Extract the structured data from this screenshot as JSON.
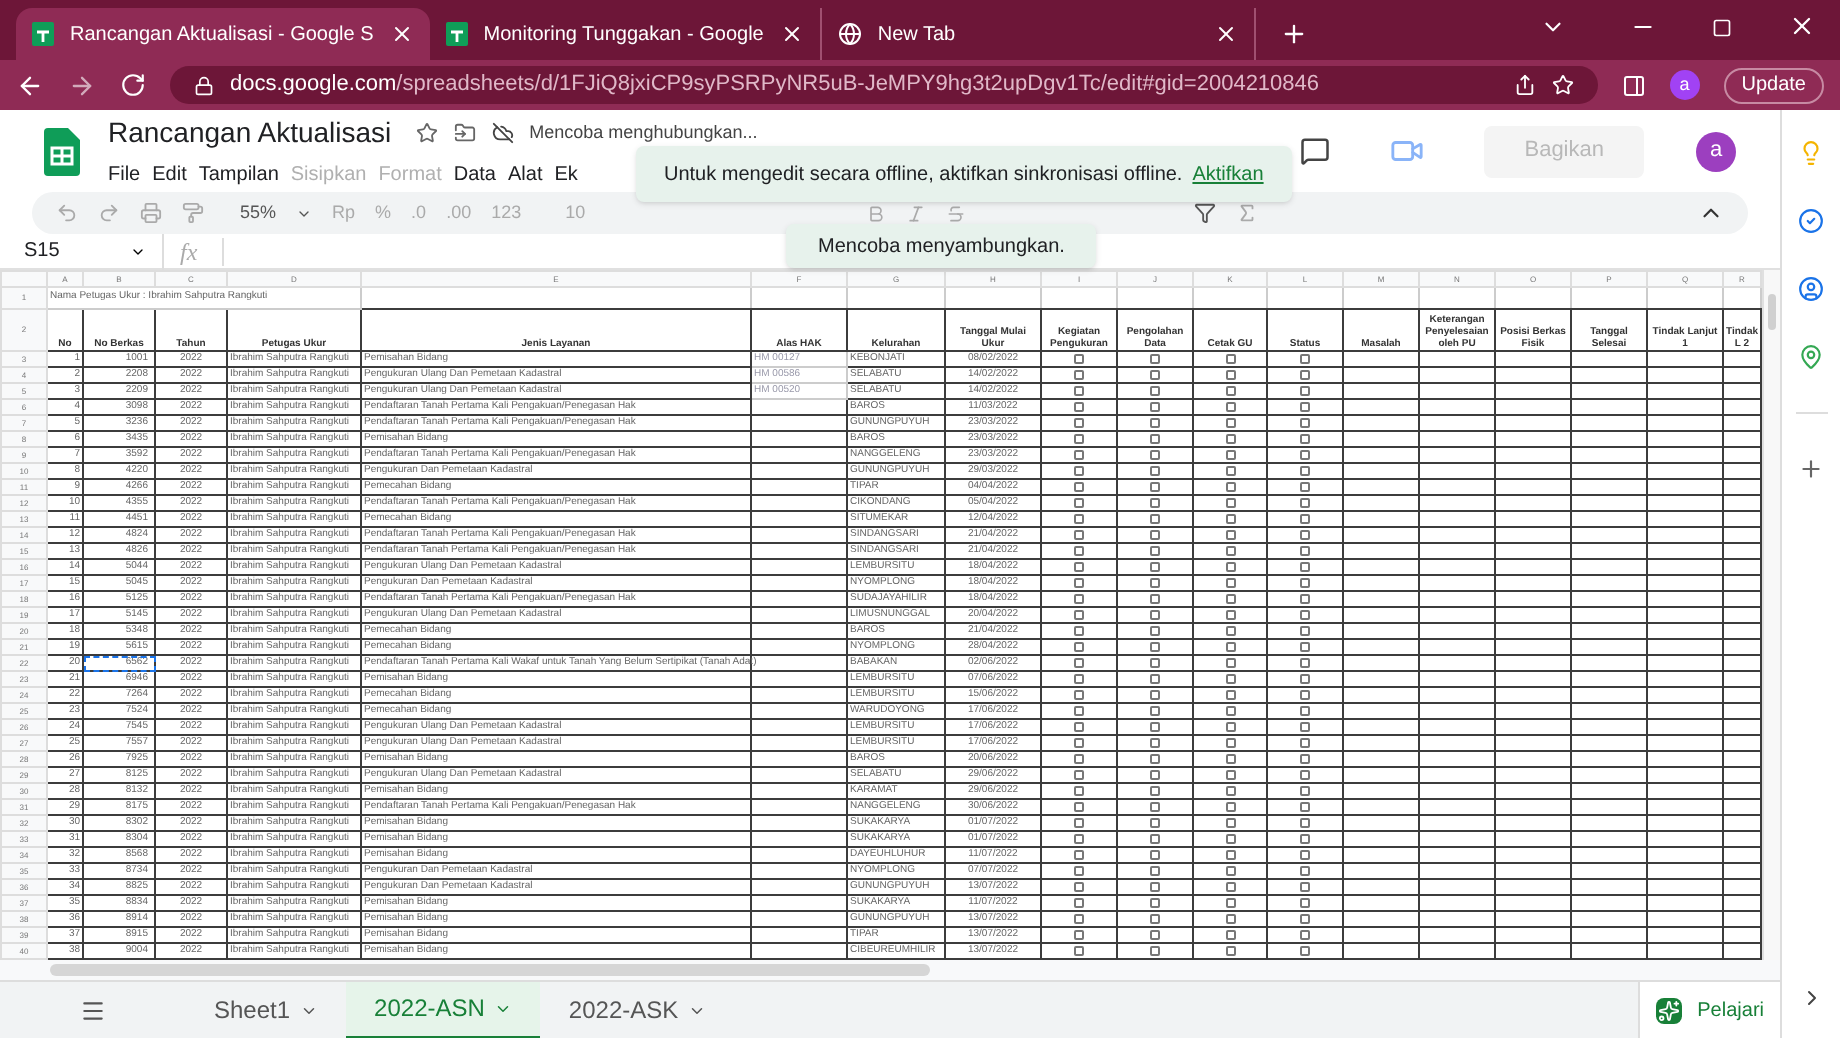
{
  "browser": {
    "tabs": [
      {
        "title": "Rancangan Aktualisasi - Google S",
        "selected": true
      },
      {
        "title": "Monitoring Tunggakan - Google",
        "selected": false
      },
      {
        "title": "New Tab",
        "selected": false
      }
    ],
    "url_host": "docs.google.com",
    "url_path": "/spreadsheets/d/1FJiQ8jxiCP9syPSRPyNR5uB-JeMPY9hg3t2upDgv1Tc/edit#gid=2004210846",
    "profile": "a",
    "update_button": "Update"
  },
  "document": {
    "title": "Rancangan Aktualisasi",
    "status": "Mencoba menghubungkan...",
    "share_button": "Bagikan",
    "avatar": "a",
    "menu": [
      {
        "label": "File",
        "disabled": false
      },
      {
        "label": "Edit",
        "disabled": false
      },
      {
        "label": "Tampilan",
        "disabled": false
      },
      {
        "label": "Sisipkan",
        "disabled": true
      },
      {
        "label": "Format",
        "disabled": true
      },
      {
        "label": "Data",
        "disabled": false
      },
      {
        "label": "Alat",
        "disabled": false
      },
      {
        "label": "Ek",
        "disabled": false
      }
    ]
  },
  "toolbar": {
    "zoom": "55%",
    "items": [
      "Rp",
      "%",
      ".0",
      ".00",
      "123"
    ],
    "font_size": "10"
  },
  "formula_bar": {
    "cell": "S15",
    "fx": "fx"
  },
  "notifications": [
    {
      "text": "Untuk mengedit secara offline, aktifkan sinkronisasi offline.",
      "link": "Aktifkan"
    },
    {
      "text": "Mencoba menyambungkan."
    }
  ],
  "sheet": {
    "column_letters": [
      "A",
      "B",
      "C",
      "D",
      "E",
      "F",
      "G",
      "H",
      "I",
      "J",
      "K",
      "L",
      "M",
      "N",
      "O",
      "P",
      "Q",
      "R"
    ],
    "title_row": {
      "row_label": "1",
      "text": "Nama Petugas Ukur : Ibrahim Sahputra Rangkuti"
    },
    "header_row": {
      "row_label": "2",
      "headers": [
        "No",
        "No Berkas",
        "Tahun",
        "Petugas Ukur",
        "Jenis Layanan",
        "Alas HAK",
        "Kelurahan",
        "Tanggal Mulai Ukur",
        "Kegiatan Pengukuran",
        "Pengolahan Data",
        "Cetak GU",
        "Status",
        "Masalah",
        "Keterangan Penyelesaian oleh PU",
        "Posisi Berkas Fisik",
        "Tanggal Selesai",
        "Tindak Lanjut 1",
        "Tindak L 2"
      ]
    },
    "rows": [
      {
        "row_label": "3",
        "no": "1",
        "berkas": "1001",
        "tahun": "2022",
        "petugas": "Ibrahim Sahputra Rangkuti",
        "layanan": "Pemisahan Bidang",
        "alas_hak": "HM 00127",
        "kelurahan": "KEBONJATI",
        "tanggal": "08/02/2022",
        "pengukuran": false,
        "pengolahan": false,
        "cetak_gu": false,
        "status": false,
        "copied": false
      },
      {
        "row_label": "4",
        "no": "2",
        "berkas": "2208",
        "tahun": "2022",
        "petugas": "Ibrahim Sahputra Rangkuti",
        "layanan": "Pengukuran Ulang Dan Pemetaan Kadastral",
        "alas_hak": "HM 00586",
        "kelurahan": "SELABATU",
        "tanggal": "14/02/2022",
        "pengukuran": false,
        "pengolahan": false,
        "cetak_gu": false,
        "status": false,
        "copied": false
      },
      {
        "row_label": "5",
        "no": "3",
        "berkas": "2209",
        "tahun": "2022",
        "petugas": "Ibrahim Sahputra Rangkuti",
        "layanan": "Pengukuran Ulang Dan Pemetaan Kadastral",
        "alas_hak": "HM 00520",
        "kelurahan": "SELABATU",
        "tanggal": "14/02/2022",
        "pengukuran": false,
        "pengolahan": false,
        "cetak_gu": false,
        "status": false,
        "copied": false
      },
      {
        "row_label": "6",
        "no": "4",
        "berkas": "3098",
        "tahun": "2022",
        "petugas": "Ibrahim Sahputra Rangkuti",
        "layanan": "Pendaftaran Tanah Pertama Kali Pengakuan/Penegasan Hak",
        "kelurahan": "BAROS",
        "tanggal": "11/03/2022",
        "pengukuran": false,
        "pengolahan": false,
        "cetak_gu": false,
        "status": false,
        "copied": false
      },
      {
        "row_label": "7",
        "no": "5",
        "berkas": "3236",
        "tahun": "2022",
        "petugas": "Ibrahim Sahputra Rangkuti",
        "layanan": "Pendaftaran Tanah Pertama Kali Pengakuan/Penegasan Hak",
        "kelurahan": "GUNUNGPUYUH",
        "tanggal": "23/03/2022",
        "pengukuran": false,
        "pengolahan": false,
        "cetak_gu": false,
        "status": false,
        "copied": false
      },
      {
        "row_label": "8",
        "no": "6",
        "berkas": "3435",
        "tahun": "2022",
        "petugas": "Ibrahim Sahputra Rangkuti",
        "layanan": "Pemisahan Bidang",
        "kelurahan": "BAROS",
        "tanggal": "23/03/2022",
        "pengukuran": false,
        "pengolahan": false,
        "cetak_gu": false,
        "status": false,
        "copied": false
      },
      {
        "row_label": "9",
        "no": "7",
        "berkas": "3592",
        "tahun": "2022",
        "petugas": "Ibrahim Sahputra Rangkuti",
        "layanan": "Pendaftaran Tanah Pertama Kali Pengakuan/Penegasan Hak",
        "kelurahan": "NANGGELENG",
        "tanggal": "23/03/2022",
        "pengukuran": false,
        "pengolahan": false,
        "cetak_gu": false,
        "status": false,
        "copied": false
      },
      {
        "row_label": "10",
        "no": "8",
        "berkas": "4220",
        "tahun": "2022",
        "petugas": "Ibrahim Sahputra Rangkuti",
        "layanan": "Pengukuran Dan Pemetaan Kadastral",
        "kelurahan": "GUNUNGPUYUH",
        "tanggal": "29/03/2022",
        "pengukuran": false,
        "pengolahan": false,
        "cetak_gu": false,
        "status": false,
        "copied": false
      },
      {
        "row_label": "11",
        "no": "9",
        "berkas": "4266",
        "tahun": "2022",
        "petugas": "Ibrahim Sahputra Rangkuti",
        "layanan": "Pemecahan Bidang",
        "kelurahan": "TIPAR",
        "tanggal": "04/04/2022",
        "pengukuran": false,
        "pengolahan": false,
        "cetak_gu": false,
        "status": false,
        "copied": false
      },
      {
        "row_label": "12",
        "no": "10",
        "berkas": "4355",
        "tahun": "2022",
        "petugas": "Ibrahim Sahputra Rangkuti",
        "layanan": "Pendaftaran Tanah Pertama Kali Pengakuan/Penegasan Hak",
        "kelurahan": "CIKONDANG",
        "tanggal": "05/04/2022",
        "pengukuran": false,
        "pengolahan": false,
        "cetak_gu": false,
        "status": false,
        "copied": false
      },
      {
        "row_label": "13",
        "no": "11",
        "berkas": "4451",
        "tahun": "2022",
        "petugas": "Ibrahim Sahputra Rangkuti",
        "layanan": "Pemecahan Bidang",
        "kelurahan": "SITUMEKAR",
        "tanggal": "12/04/2022",
        "pengukuran": false,
        "pengolahan": false,
        "cetak_gu": false,
        "status": false,
        "copied": false
      },
      {
        "row_label": "14",
        "no": "12",
        "berkas": "4824",
        "tahun": "2022",
        "petugas": "Ibrahim Sahputra Rangkuti",
        "layanan": "Pendaftaran Tanah Pertama Kali Pengakuan/Penegasan Hak",
        "kelurahan": "SINDANGSARI",
        "tanggal": "21/04/2022",
        "pengukuran": false,
        "pengolahan": false,
        "cetak_gu": false,
        "status": false,
        "copied": false
      },
      {
        "row_label": "15",
        "no": "13",
        "berkas": "4826",
        "tahun": "2022",
        "petugas": "Ibrahim Sahputra Rangkuti",
        "layanan": "Pendaftaran Tanah Pertama Kali Pengakuan/Penegasan Hak",
        "kelurahan": "SINDANGSARI",
        "tanggal": "21/04/2022",
        "pengukuran": false,
        "pengolahan": false,
        "cetak_gu": false,
        "status": false,
        "copied": false
      },
      {
        "row_label": "16",
        "no": "14",
        "berkas": "5044",
        "tahun": "2022",
        "petugas": "Ibrahim Sahputra Rangkuti",
        "layanan": "Pengukuran Ulang Dan Pemetaan Kadastral",
        "kelurahan": "LEMBURSITU",
        "tanggal": "18/04/2022",
        "pengukuran": false,
        "pengolahan": false,
        "cetak_gu": false,
        "status": false,
        "copied": false
      },
      {
        "row_label": "17",
        "no": "15",
        "berkas": "5045",
        "tahun": "2022",
        "petugas": "Ibrahim Sahputra Rangkuti",
        "layanan": "Pengukuran Dan Pemetaan Kadastral",
        "kelurahan": "NYOMPLONG",
        "tanggal": "18/04/2022",
        "pengukuran": false,
        "pengolahan": false,
        "cetak_gu": false,
        "status": false,
        "copied": false
      },
      {
        "row_label": "18",
        "no": "16",
        "berkas": "5125",
        "tahun": "2022",
        "petugas": "Ibrahim Sahputra Rangkuti",
        "layanan": "Pendaftaran Tanah Pertama Kali Pengakuan/Penegasan Hak",
        "kelurahan": "SUDAJAYAHILIR",
        "tanggal": "18/04/2022",
        "pengukuran": false,
        "pengolahan": false,
        "cetak_gu": false,
        "status": false,
        "copied": false
      },
      {
        "row_label": "19",
        "no": "17",
        "berkas": "5145",
        "tahun": "2022",
        "petugas": "Ibrahim Sahputra Rangkuti",
        "layanan": "Pengukuran Ulang Dan Pemetaan Kadastral",
        "kelurahan": "LIMUSNUNGGAL",
        "tanggal": "20/04/2022",
        "pengukuran": false,
        "pengolahan": false,
        "cetak_gu": false,
        "status": false,
        "copied": false
      },
      {
        "row_label": "20",
        "no": "18",
        "berkas": "5348",
        "tahun": "2022",
        "petugas": "Ibrahim Sahputra Rangkuti",
        "layanan": "Pemecahan Bidang",
        "kelurahan": "BAROS",
        "tanggal": "21/04/2022",
        "pengukuran": false,
        "pengolahan": false,
        "cetak_gu": false,
        "status": false,
        "copied": false
      },
      {
        "row_label": "21",
        "no": "19",
        "berkas": "5615",
        "tahun": "2022",
        "petugas": "Ibrahim Sahputra Rangkuti",
        "layanan": "Pemecahan Bidang",
        "kelurahan": "NYOMPLONG",
        "tanggal": "28/04/2022",
        "pengukuran": false,
        "pengolahan": false,
        "cetak_gu": false,
        "status": false,
        "copied": false
      },
      {
        "row_label": "22",
        "no": "20",
        "berkas": "6562",
        "tahun": "2022",
        "petugas": "Ibrahim Sahputra Rangkuti",
        "layanan": "Pendaftaran Tanah Pertama Kali Wakaf untuk Tanah Yang Belum Sertipikat (Tanah Adat)",
        "kelurahan": "BABAKAN",
        "tanggal": "02/06/2022",
        "pengukuran": false,
        "pengolahan": false,
        "cetak_gu": false,
        "status": false,
        "copied": true
      },
      {
        "row_label": "23",
        "no": "21",
        "berkas": "6946",
        "tahun": "2022",
        "petugas": "Ibrahim Sahputra Rangkuti",
        "layanan": "Pemisahan Bidang",
        "kelurahan": "LEMBURSITU",
        "tanggal": "07/06/2022",
        "pengukuran": false,
        "pengolahan": false,
        "cetak_gu": false,
        "status": false,
        "copied": false
      },
      {
        "row_label": "24",
        "no": "22",
        "berkas": "7264",
        "tahun": "2022",
        "petugas": "Ibrahim Sahputra Rangkuti",
        "layanan": "Pemecahan Bidang",
        "kelurahan": "LEMBURSITU",
        "tanggal": "15/06/2022",
        "pengukuran": false,
        "pengolahan": false,
        "cetak_gu": false,
        "status": false,
        "copied": false
      },
      {
        "row_label": "25",
        "no": "23",
        "berkas": "7524",
        "tahun": "2022",
        "petugas": "Ibrahim Sahputra Rangkuti",
        "layanan": "Pemecahan Bidang",
        "kelurahan": "WARUDOYONG",
        "tanggal": "17/06/2022",
        "pengukuran": false,
        "pengolahan": false,
        "cetak_gu": false,
        "status": false,
        "copied": false
      },
      {
        "row_label": "26",
        "no": "24",
        "berkas": "7545",
        "tahun": "2022",
        "petugas": "Ibrahim Sahputra Rangkuti",
        "layanan": "Pengukuran Ulang Dan Pemetaan Kadastral",
        "kelurahan": "LEMBURSITU",
        "tanggal": "17/06/2022",
        "pengukuran": false,
        "pengolahan": false,
        "cetak_gu": false,
        "status": false,
        "copied": false
      },
      {
        "row_label": "27",
        "no": "25",
        "berkas": "7557",
        "tahun": "2022",
        "petugas": "Ibrahim Sahputra Rangkuti",
        "layanan": "Pengukuran Ulang Dan Pemetaan Kadastral",
        "kelurahan": "LEMBURSITU",
        "tanggal": "17/06/2022",
        "pengukuran": false,
        "pengolahan": false,
        "cetak_gu": false,
        "status": false,
        "copied": false
      },
      {
        "row_label": "28",
        "no": "26",
        "berkas": "7925",
        "tahun": "2022",
        "petugas": "Ibrahim Sahputra Rangkuti",
        "layanan": "Pemisahan Bidang",
        "kelurahan": "BAROS",
        "tanggal": "20/06/2022",
        "pengukuran": false,
        "pengolahan": false,
        "cetak_gu": false,
        "status": false,
        "copied": false
      },
      {
        "row_label": "29",
        "no": "27",
        "berkas": "8125",
        "tahun": "2022",
        "petugas": "Ibrahim Sahputra Rangkuti",
        "layanan": "Pengukuran Ulang Dan Pemetaan Kadastral",
        "kelurahan": "SELABATU",
        "tanggal": "29/06/2022",
        "pengukuran": false,
        "pengolahan": false,
        "cetak_gu": false,
        "status": false,
        "copied": false
      },
      {
        "row_label": "30",
        "no": "28",
        "berkas": "8132",
        "tahun": "2022",
        "petugas": "Ibrahim Sahputra Rangkuti",
        "layanan": "Pemisahan Bidang",
        "kelurahan": "KARAMAT",
        "tanggal": "29/06/2022",
        "pengukuran": false,
        "pengolahan": false,
        "cetak_gu": false,
        "status": false,
        "copied": false
      },
      {
        "row_label": "31",
        "no": "29",
        "berkas": "8175",
        "tahun": "2022",
        "petugas": "Ibrahim Sahputra Rangkuti",
        "layanan": "Pendaftaran Tanah Pertama Kali Pengakuan/Penegasan Hak",
        "kelurahan": "NANGGELENG",
        "tanggal": "30/06/2022",
        "pengukuran": false,
        "pengolahan": false,
        "cetak_gu": false,
        "status": false,
        "copied": false
      },
      {
        "row_label": "32",
        "no": "30",
        "berkas": "8302",
        "tahun": "2022",
        "petugas": "Ibrahim Sahputra Rangkuti",
        "layanan": "Pemisahan Bidang",
        "kelurahan": "SUKAKARYA",
        "tanggal": "01/07/2022",
        "pengukuran": false,
        "pengolahan": false,
        "cetak_gu": false,
        "status": false,
        "copied": false
      },
      {
        "row_label": "33",
        "no": "31",
        "berkas": "8304",
        "tahun": "2022",
        "petugas": "Ibrahim Sahputra Rangkuti",
        "layanan": "Pemisahan Bidang",
        "kelurahan": "SUKAKARYA",
        "tanggal": "01/07/2022",
        "pengukuran": false,
        "pengolahan": false,
        "cetak_gu": false,
        "status": false,
        "copied": false
      },
      {
        "row_label": "34",
        "no": "32",
        "berkas": "8568",
        "tahun": "2022",
        "petugas": "Ibrahim Sahputra Rangkuti",
        "layanan": "Pemisahan Bidang",
        "kelurahan": "DAYEUHLUHUR",
        "tanggal": "11/07/2022",
        "pengukuran": false,
        "pengolahan": false,
        "cetak_gu": false,
        "status": false,
        "copied": false
      },
      {
        "row_label": "35",
        "no": "33",
        "berkas": "8734",
        "tahun": "2022",
        "petugas": "Ibrahim Sahputra Rangkuti",
        "layanan": "Pengukuran Dan Pemetaan Kadastral",
        "kelurahan": "NYOMPLONG",
        "tanggal": "07/07/2022",
        "pengukuran": false,
        "pengolahan": false,
        "cetak_gu": false,
        "status": false,
        "copied": false
      },
      {
        "row_label": "36",
        "no": "34",
        "berkas": "8825",
        "tahun": "2022",
        "petugas": "Ibrahim Sahputra Rangkuti",
        "layanan": "Pengukuran Dan Pemetaan Kadastral",
        "kelurahan": "GUNUNGPUYUH",
        "tanggal": "13/07/2022",
        "pengukuran": false,
        "pengolahan": false,
        "cetak_gu": false,
        "status": false,
        "copied": false
      },
      {
        "row_label": "37",
        "no": "35",
        "berkas": "8834",
        "tahun": "2022",
        "petugas": "Ibrahim Sahputra Rangkuti",
        "layanan": "Pemisahan Bidang",
        "kelurahan": "SUKAKARYA",
        "tanggal": "11/07/2022",
        "pengukuran": false,
        "pengolahan": false,
        "cetak_gu": false,
        "status": false,
        "copied": false
      },
      {
        "row_label": "38",
        "no": "36",
        "berkas": "8914",
        "tahun": "2022",
        "petugas": "Ibrahim Sahputra Rangkuti",
        "layanan": "Pemisahan Bidang",
        "kelurahan": "GUNUNGPUYUH",
        "tanggal": "13/07/2022",
        "pengukuran": false,
        "pengolahan": false,
        "cetak_gu": false,
        "status": false,
        "copied": false
      },
      {
        "row_label": "39",
        "no": "37",
        "berkas": "8915",
        "tahun": "2022",
        "petugas": "Ibrahim Sahputra Rangkuti",
        "layanan": "Pemisahan Bidang",
        "kelurahan": "TIPAR",
        "tanggal": "13/07/2022",
        "pengukuran": false,
        "pengolahan": false,
        "cetak_gu": false,
        "status": false,
        "copied": false
      },
      {
        "row_label": "40",
        "no": "38",
        "berkas": "9004",
        "tahun": "2022",
        "petugas": "Ibrahim Sahputra Rangkuti",
        "layanan": "Pemisahan Bidang",
        "kelurahan": "CIBEUREUMHILIR",
        "tanggal": "13/07/2022",
        "pengukuran": false,
        "pengolahan": false,
        "cetak_gu": false,
        "status": false,
        "copied": false
      }
    ]
  },
  "sheet_tabs": [
    {
      "label": "Sheet1",
      "selected": false
    },
    {
      "label": "2022-ASN",
      "selected": true
    },
    {
      "label": "2022-ASK",
      "selected": false
    }
  ],
  "explore_button": "Pelajari"
}
